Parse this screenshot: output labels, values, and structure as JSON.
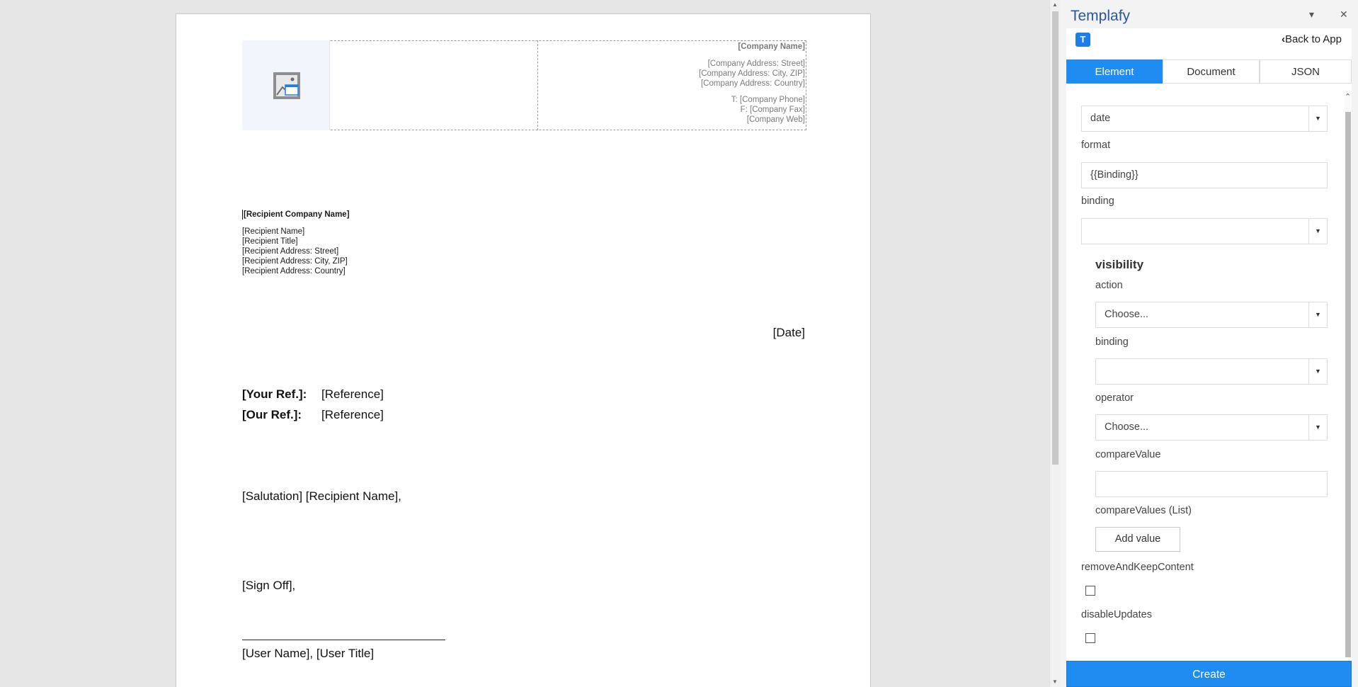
{
  "document": {
    "company": {
      "name": "[Company Name]",
      "street": "[Company Address: Street]",
      "city": "[Company Address: City, ZIP]",
      "country": "[Company Address: Country]",
      "phone": "T: [Company Phone]",
      "fax": "F: [Company Fax]",
      "web": "[Company Web]"
    },
    "recipient": {
      "company": "[Recipient Company Name]",
      "name": "[Recipient Name]",
      "title": "[Recipient Title]",
      "street": "[Recipient Address: Street]",
      "city": "[Recipient Address: City, ZIP]",
      "country": "[Recipient Address: Country]"
    },
    "date": "[Date]",
    "your_ref_label": "[Your Ref.]:",
    "your_ref_value": "[Reference]",
    "our_ref_label": "[Our Ref.]:",
    "our_ref_value": "[Reference]",
    "salutation": "[Salutation] [Recipient Name],",
    "sign_off": "[Sign Off],",
    "signature": "[User Name], [User Title]"
  },
  "panel": {
    "title": "Templafy",
    "collapse_icon": "chevron-down-icon",
    "close_icon": "close-icon",
    "close_glyph": "✕",
    "collapse_glyph": "▾",
    "app_badge": "T",
    "back_label": "Back to App",
    "back_glyph": "‹",
    "tabs": [
      {
        "label": "Element",
        "active": true
      },
      {
        "label": "Document",
        "active": false
      },
      {
        "label": "JSON",
        "active": false
      }
    ],
    "form": {
      "type_value": "date",
      "format_label": "format",
      "format_value": "{{Binding}}",
      "binding_label": "binding",
      "binding_value": "",
      "visibility_title": "visibility",
      "action_label": "action",
      "action_value": "Choose...",
      "vis_binding_label": "binding",
      "vis_binding_value": "",
      "operator_label": "operator",
      "operator_value": "Choose...",
      "compare_value_label": "compareValue",
      "compare_value": "",
      "compare_values_label": "compareValues (List)",
      "add_value_label": "Add value",
      "remove_keep_label": "removeAndKeepContent",
      "remove_keep_checked": false,
      "disable_updates_label": "disableUpdates",
      "disable_updates_checked": false
    },
    "create_label": "Create",
    "accent_color": "#1f8cf2",
    "title_color": "#2b579a"
  }
}
